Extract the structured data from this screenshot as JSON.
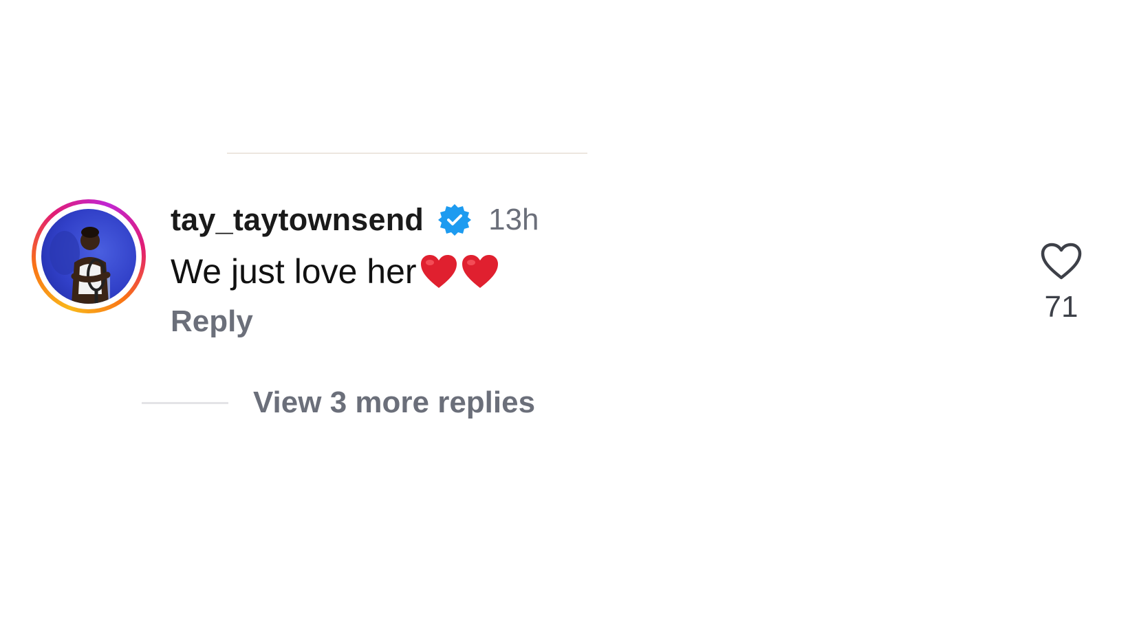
{
  "comment": {
    "username": "tay_taytownsend",
    "verified_icon": "verified-badge-icon",
    "timestamp": "13h",
    "text": "We just love her",
    "emojis": [
      "❤️",
      "❤️"
    ],
    "reply_label": "Reply",
    "like_icon": "heart-outline-icon",
    "like_count": "71"
  },
  "replies": {
    "view_more_label": "View 3 more replies"
  },
  "colors": {
    "verified_blue": "#1d9bf0",
    "heart_red": "#e0202f",
    "muted_text": "#6b6f7a"
  }
}
